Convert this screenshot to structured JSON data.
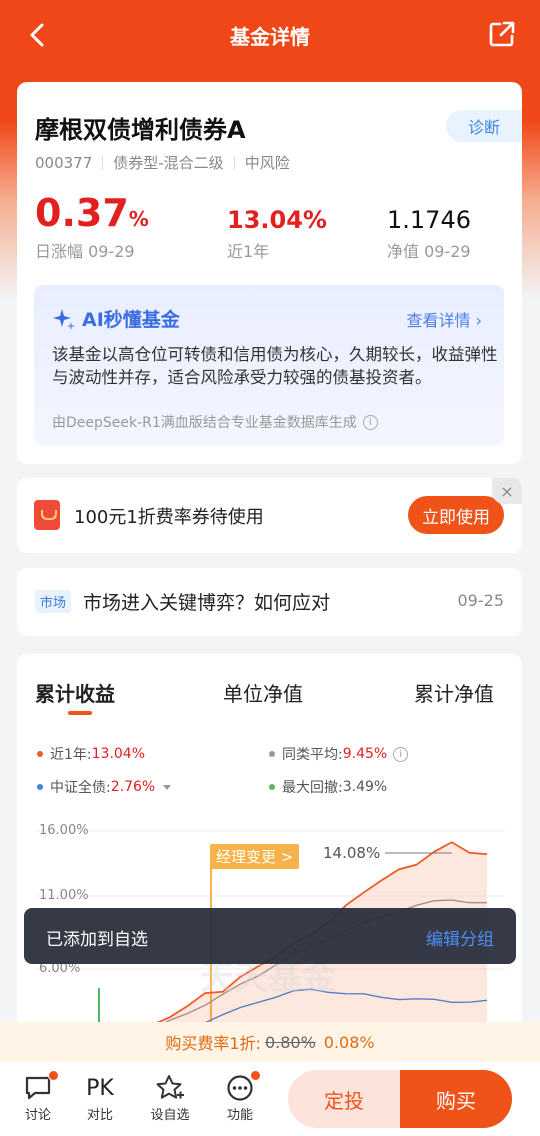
{
  "header": {
    "title": "基金详情"
  },
  "fund": {
    "name": "摩根双债增利债券A",
    "diagnose_label": "诊断",
    "code": "000377",
    "type": "债券型-混合二级",
    "risk": "中风险",
    "daily_change": "0.37",
    "daily_change_unit": "%",
    "daily_change_label": "日涨幅 09-29",
    "one_year_return": "13.04%",
    "one_year_label": "近1年",
    "nav": "1.1746",
    "nav_label": "净值 09-29"
  },
  "ai": {
    "title": "AI秒懂基金",
    "more": "查看详情 ›",
    "text": "该基金以高仓位可转债和信用债为核心，久期较长，收益弹性与波动性并存，适合风险承受力较强的债基投资者。",
    "note": "由DeepSeek-R1满血版结合专业基金数据库生成",
    "info_icon": "i"
  },
  "coupon": {
    "text": "100元1折费率券待使用",
    "button": "立即使用",
    "close": "×"
  },
  "news": {
    "tag": "市场",
    "title": "市场进入关键博弈？如何应对",
    "date": "09-25"
  },
  "chart": {
    "tabs": [
      "累计收益",
      "单位净值",
      "累计净值"
    ],
    "legend": {
      "fund_label": "近1年:",
      "fund_value": "13.04%",
      "peer_label": "同类平均:",
      "peer_value": "9.45%",
      "index_label": "中证全债:",
      "index_value": "2.76%",
      "drawdown_label": "最大回撤:",
      "drawdown_value": "3.49%"
    },
    "yticks": [
      "16.00%",
      "11.00%",
      "6.00%"
    ],
    "manager_change": "经理变更 >",
    "peak_label": "14.08%",
    "watermark": "天天基金"
  },
  "chart_data": {
    "type": "line",
    "title": "",
    "ylabel": "",
    "ylim": [
      1,
      16
    ],
    "yticks": [
      16,
      11,
      6
    ],
    "peak": 14.08,
    "series": [
      {
        "name": "近1年",
        "color": "#f05a24",
        "values": [
          0,
          0.5,
          1.0,
          1.8,
          2.5,
          3.2,
          3.6,
          4.4,
          5.1,
          6.0,
          6.6,
          7.4,
          8.3,
          9.2,
          10.4,
          11.2,
          11.9,
          12.6,
          13.3,
          14.08,
          13.5,
          13.04
        ]
      },
      {
        "name": "同类平均",
        "color": "#9a9a9a",
        "values": [
          0,
          0.3,
          0.8,
          1.4,
          2.0,
          2.6,
          3.2,
          3.9,
          4.6,
          5.3,
          5.9,
          6.5,
          7.1,
          7.6,
          8.1,
          8.6,
          9.0,
          9.3,
          9.6,
          9.8,
          9.6,
          9.45
        ]
      },
      {
        "name": "中证全债",
        "color": "#3d86de",
        "values": [
          0,
          0.2,
          0.4,
          0.7,
          1.0,
          1.4,
          1.8,
          2.3,
          2.8,
          3.1,
          3.4,
          3.6,
          3.5,
          3.3,
          3.2,
          3.1,
          3.0,
          2.9,
          2.85,
          2.8,
          2.78,
          2.76
        ]
      }
    ],
    "drawdown": 3.49
  },
  "toast": {
    "message": "已添加到自选",
    "action": "编辑分组"
  },
  "fee": {
    "prefix": "购买费率1折:",
    "old": "0.80%",
    "new": "0.08%"
  },
  "bottom": {
    "discuss": "讨论",
    "compare_icon": "PK",
    "compare": "对比",
    "watch": "设自选",
    "function": "功能",
    "sip": "定投",
    "buy": "购买"
  },
  "colors": {
    "brand": "#ef4718",
    "rise": "#e32020",
    "accent_blue": "#3d86de"
  }
}
